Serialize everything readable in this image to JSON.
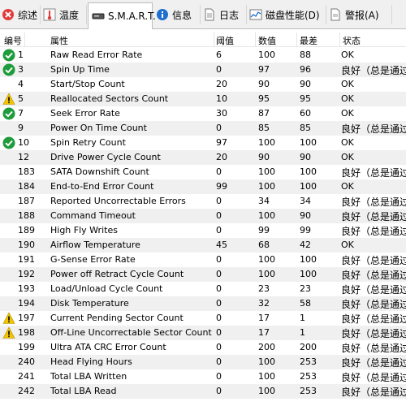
{
  "tabs": [
    {
      "label": "综述",
      "icon": "red-x-icon"
    },
    {
      "label": "温度",
      "icon": "thermometer-icon"
    },
    {
      "label": "S.M.A.R.T.",
      "icon": "drive-icon",
      "active": true
    },
    {
      "label": "信息",
      "icon": "info-icon"
    },
    {
      "label": "日志",
      "icon": "log-icon"
    },
    {
      "label": "磁盘性能(D)",
      "icon": "performance-chart-icon"
    },
    {
      "label": "警报(A)",
      "icon": "alert-icon"
    }
  ],
  "columns": {
    "id": "编号",
    "attribute": "属性",
    "threshold": "阈值",
    "value": "数值",
    "worst": "最差",
    "status": "状态"
  },
  "rows": [
    {
      "id": "1",
      "name": "Raw Read Error Rate",
      "thr": "6",
      "val": "100",
      "worst": "88",
      "status": "OK",
      "icon": "ok"
    },
    {
      "id": "3",
      "name": "Spin Up Time",
      "thr": "0",
      "val": "97",
      "worst": "96",
      "status": "良好（总是通过）",
      "icon": "ok"
    },
    {
      "id": "4",
      "name": "Start/Stop Count",
      "thr": "20",
      "val": "90",
      "worst": "90",
      "status": "OK",
      "icon": ""
    },
    {
      "id": "5",
      "name": "Reallocated Sectors Count",
      "thr": "10",
      "val": "95",
      "worst": "95",
      "status": "OK",
      "icon": "warn"
    },
    {
      "id": "7",
      "name": "Seek Error Rate",
      "thr": "30",
      "val": "87",
      "worst": "60",
      "status": "OK",
      "icon": "ok"
    },
    {
      "id": "9",
      "name": "Power On Time Count",
      "thr": "0",
      "val": "85",
      "worst": "85",
      "status": "良好（总是通过）",
      "icon": ""
    },
    {
      "id": "10",
      "name": "Spin Retry Count",
      "thr": "97",
      "val": "100",
      "worst": "100",
      "status": "OK",
      "icon": "ok"
    },
    {
      "id": "12",
      "name": "Drive Power Cycle Count",
      "thr": "20",
      "val": "90",
      "worst": "90",
      "status": "OK",
      "icon": ""
    },
    {
      "id": "183",
      "name": "SATA Downshift Count",
      "thr": "0",
      "val": "100",
      "worst": "100",
      "status": "良好（总是通过）",
      "icon": ""
    },
    {
      "id": "184",
      "name": "End-to-End Error Count",
      "thr": "99",
      "val": "100",
      "worst": "100",
      "status": "OK",
      "icon": ""
    },
    {
      "id": "187",
      "name": "Reported Uncorrectable Errors",
      "thr": "0",
      "val": "34",
      "worst": "34",
      "status": "良好（总是通过）",
      "icon": ""
    },
    {
      "id": "188",
      "name": "Command Timeout",
      "thr": "0",
      "val": "100",
      "worst": "90",
      "status": "良好（总是通过）",
      "icon": ""
    },
    {
      "id": "189",
      "name": "High Fly Writes",
      "thr": "0",
      "val": "99",
      "worst": "99",
      "status": "良好（总是通过）",
      "icon": ""
    },
    {
      "id": "190",
      "name": "Airflow Temperature",
      "thr": "45",
      "val": "68",
      "worst": "42",
      "status": "OK",
      "icon": ""
    },
    {
      "id": "191",
      "name": "G-Sense Error Rate",
      "thr": "0",
      "val": "100",
      "worst": "100",
      "status": "良好（总是通过）",
      "icon": ""
    },
    {
      "id": "192",
      "name": "Power off Retract Cycle Count",
      "thr": "0",
      "val": "100",
      "worst": "100",
      "status": "良好（总是通过）",
      "icon": ""
    },
    {
      "id": "193",
      "name": "Load/Unload Cycle Count",
      "thr": "0",
      "val": "23",
      "worst": "23",
      "status": "良好（总是通过）",
      "icon": ""
    },
    {
      "id": "194",
      "name": "Disk Temperature",
      "thr": "0",
      "val": "32",
      "worst": "58",
      "status": "良好（总是通过）",
      "icon": ""
    },
    {
      "id": "197",
      "name": "Current Pending Sector Count",
      "thr": "0",
      "val": "17",
      "worst": "1",
      "status": "良好（总是通过）",
      "icon": "warn"
    },
    {
      "id": "198",
      "name": "Off-Line Uncorrectable Sector Count",
      "thr": "0",
      "val": "17",
      "worst": "1",
      "status": "良好（总是通过）",
      "icon": "warn"
    },
    {
      "id": "199",
      "name": "Ultra ATA CRC Error Count",
      "thr": "0",
      "val": "200",
      "worst": "200",
      "status": "良好（总是通过）",
      "icon": ""
    },
    {
      "id": "240",
      "name": "Head Flying Hours",
      "thr": "0",
      "val": "100",
      "worst": "253",
      "status": "良好（总是通过）",
      "icon": ""
    },
    {
      "id": "241",
      "name": "Total LBA Written",
      "thr": "0",
      "val": "100",
      "worst": "253",
      "status": "良好（总是通过）",
      "icon": ""
    },
    {
      "id": "242",
      "name": "Total LBA Read",
      "thr": "0",
      "val": "100",
      "worst": "253",
      "status": "良好（总是通过）",
      "icon": ""
    }
  ],
  "colors": {
    "ok": "#1e9c3c",
    "warn": "#f2c500",
    "error": "#e23b3b",
    "info": "#1f6fd1",
    "row_shade": "#f0f0f0"
  }
}
